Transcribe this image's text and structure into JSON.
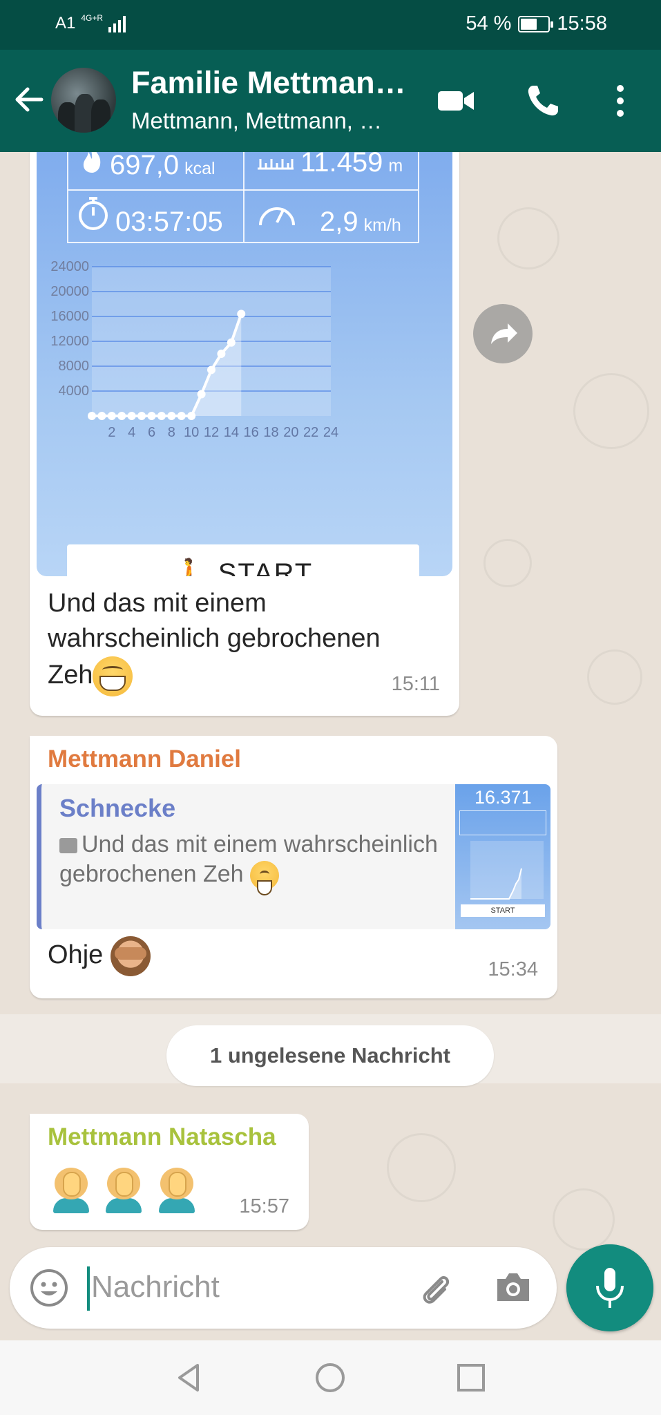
{
  "status_bar": {
    "carrier": "A1",
    "network": "4G+R",
    "battery_percent": "54 %",
    "battery_level": 0.54,
    "time": "15:58"
  },
  "header": {
    "title": "Familie Mettman…",
    "subtitle": "Mettmann, Mettmann, …",
    "icons": [
      "back-arrow-icon",
      "video-call-icon",
      "phone-icon",
      "more-vert-icon"
    ]
  },
  "messages": [
    {
      "type": "image",
      "caption_line1": "Und das mit einem",
      "caption_line2": "wahrscheinlich gebrochenen",
      "caption_line3": "Zeh",
      "time": "15:11",
      "screenshot": {
        "kcal": "697,0",
        "kcal_unit": "kcal",
        "distance": "11.459",
        "distance_unit": "m",
        "duration": "03:57:05",
        "speed": "2,9",
        "speed_unit": "km/h",
        "start_label": "START"
      }
    },
    {
      "type": "reply",
      "sender": "Mettmann Daniel",
      "sender_color": "#e07a3f",
      "quote_name": "Schnecke",
      "quote_text": "Und das mit einem wahrscheinlich gebrochenen Zeh",
      "thumb_steps": "16.371",
      "thumb_start": "START",
      "text": "Ohje",
      "time": "15:34"
    },
    {
      "type": "text",
      "sender": "Mettmann Natascha",
      "sender_color": "#a8c23d",
      "time": "15:57"
    }
  ],
  "unread_divider": "1 ungelesene Nachricht",
  "input": {
    "placeholder": "Nachricht"
  },
  "chart_data": {
    "type": "area",
    "x": [
      0,
      1,
      2,
      3,
      4,
      5,
      6,
      7,
      8,
      9,
      10,
      11,
      12,
      13,
      14,
      15
    ],
    "values": [
      0,
      0,
      0,
      0,
      0,
      0,
      0,
      0,
      0,
      0,
      0,
      3500,
      7400,
      10000,
      11800,
      16400
    ],
    "x_ticks": [
      "2",
      "4",
      "6",
      "8",
      "10",
      "12",
      "14",
      "16",
      "18",
      "20",
      "22",
      "24"
    ],
    "y_ticks": [
      "24000",
      "20000",
      "16000",
      "12000",
      "8000",
      "4000"
    ],
    "xlim": [
      0,
      24
    ],
    "ylim": [
      0,
      24000
    ],
    "grid": true
  }
}
